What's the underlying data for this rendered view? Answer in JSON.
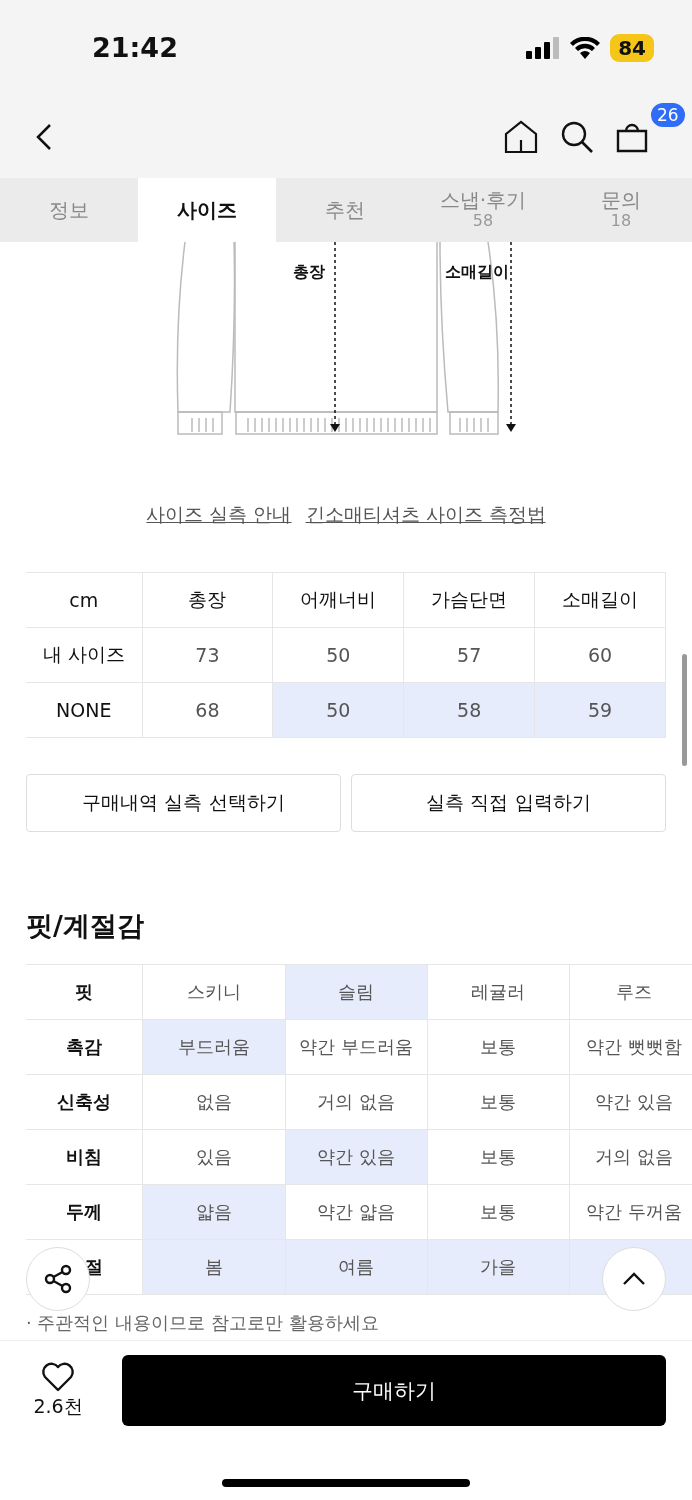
{
  "status_bar": {
    "time": "21:42",
    "battery": "84"
  },
  "nav": {
    "cart_count": "26"
  },
  "tabs": [
    {
      "label": "정보",
      "selected": false
    },
    {
      "label": "사이즈",
      "selected": true
    },
    {
      "label": "추천",
      "selected": false
    },
    {
      "label": "스냅·후기",
      "count": "58",
      "selected": false
    },
    {
      "label": "문의",
      "count": "18",
      "selected": false
    }
  ],
  "diagram": {
    "labels": [
      "총장",
      "소매길이"
    ]
  },
  "guide_links": [
    "사이즈 실측 안내",
    "긴소매티셔츠 사이즈 측정법"
  ],
  "size_table": {
    "corner": "cm",
    "columns": [
      "총장",
      "어깨너비",
      "가슴단면",
      "소매길이"
    ],
    "rows": [
      {
        "label": "내 사이즈",
        "cells": [
          {
            "text": "73",
            "selected": false
          },
          {
            "text": "50",
            "selected": false
          },
          {
            "text": "57",
            "selected": false
          },
          {
            "text": "60",
            "selected": false
          }
        ]
      },
      {
        "label": "NONE",
        "cells": [
          {
            "text": "68",
            "selected": false
          },
          {
            "text": "50",
            "selected": true
          },
          {
            "text": "58",
            "selected": true
          },
          {
            "text": "59",
            "selected": true
          }
        ]
      }
    ]
  },
  "size_buttons": [
    "구매내역 실측 선택하기",
    "실측 직접 입력하기"
  ],
  "fit_section": {
    "title": "핏/계절감",
    "rows": [
      {
        "label": "핏",
        "cells": [
          {
            "text": "스키니",
            "selected": false
          },
          {
            "text": "슬림",
            "selected": true
          },
          {
            "text": "레귤러",
            "selected": false
          },
          {
            "text": "루즈",
            "selected": false
          }
        ]
      },
      {
        "label": "촉감",
        "cells": [
          {
            "text": "부드러움",
            "selected": true
          },
          {
            "text": "약간 부드러움",
            "selected": false
          },
          {
            "text": "보통",
            "selected": false
          },
          {
            "text": "약간 뻣뻣함",
            "selected": false
          }
        ]
      },
      {
        "label": "신축성",
        "cells": [
          {
            "text": "없음",
            "selected": false
          },
          {
            "text": "거의 없음",
            "selected": false
          },
          {
            "text": "보통",
            "selected": false
          },
          {
            "text": "약간 있음",
            "selected": false
          }
        ]
      },
      {
        "label": "비침",
        "cells": [
          {
            "text": "있음",
            "selected": false
          },
          {
            "text": "약간 있음",
            "selected": true
          },
          {
            "text": "보통",
            "selected": false
          },
          {
            "text": "거의 없음",
            "selected": false
          }
        ]
      },
      {
        "label": "두께",
        "cells": [
          {
            "text": "얇음",
            "selected": true
          },
          {
            "text": "약간 얇음",
            "selected": false
          },
          {
            "text": "보통",
            "selected": false
          },
          {
            "text": "약간 두꺼움",
            "selected": false
          }
        ]
      },
      {
        "label": "절",
        "cells": [
          {
            "text": "봄",
            "selected": true
          },
          {
            "text": "여름",
            "selected": true
          },
          {
            "text": "가을",
            "selected": true
          },
          {
            "selected": true
          }
        ]
      }
    ],
    "note": "· 주관적인 내용이므로 참고로만 활용하세요"
  },
  "bottom_bar": {
    "likes": "2.6천",
    "buy_button": "구매하기"
  }
}
